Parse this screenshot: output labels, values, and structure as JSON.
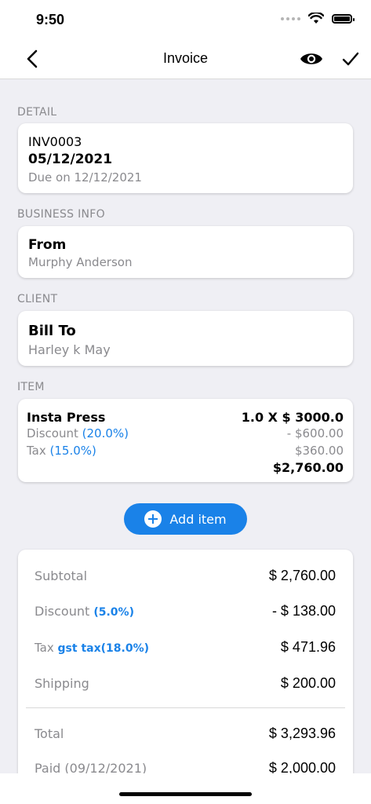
{
  "status": {
    "time": "9:50"
  },
  "nav": {
    "title": "Invoice"
  },
  "detail": {
    "section_label": "DETAIL",
    "number": "INV0003",
    "date": "05/12/2021",
    "due": "Due on 12/12/2021"
  },
  "business": {
    "section_label": "BUSINESS INFO",
    "heading": "From",
    "name": "Murphy Anderson"
  },
  "client": {
    "section_label": "CLIENT",
    "heading": "Bill To",
    "name": "Harley k May"
  },
  "item": {
    "section_label": "ITEM",
    "name": "Insta Press",
    "qty_price": "1.0 X $ 3000.0",
    "discount_label": "Discount",
    "discount_pct": "(20.0%)",
    "discount_value": "- $600.00",
    "tax_label": "Tax",
    "tax_pct": "(15.0%)",
    "tax_value": "$360.00",
    "total": "$2,760.00"
  },
  "add_item": {
    "label": "Add item"
  },
  "summary": {
    "subtotal_label": "Subtotal",
    "subtotal_value": "$ 2,760.00",
    "discount_label": "Discount",
    "discount_pct": "(5.0%)",
    "discount_value": "- $ 138.00",
    "tax_label": "Tax",
    "tax_name": "gst tax(18.0%)",
    "tax_value": "$ 471.96",
    "shipping_label": "Shipping",
    "shipping_value": "$ 200.00",
    "total_label": "Total",
    "total_value": "$ 3,293.96",
    "paid_label": "Paid (09/12/2021)",
    "paid_value": "$ 2,000.00"
  },
  "colors": {
    "accent": "#1a82e8",
    "background": "#efeff4"
  }
}
